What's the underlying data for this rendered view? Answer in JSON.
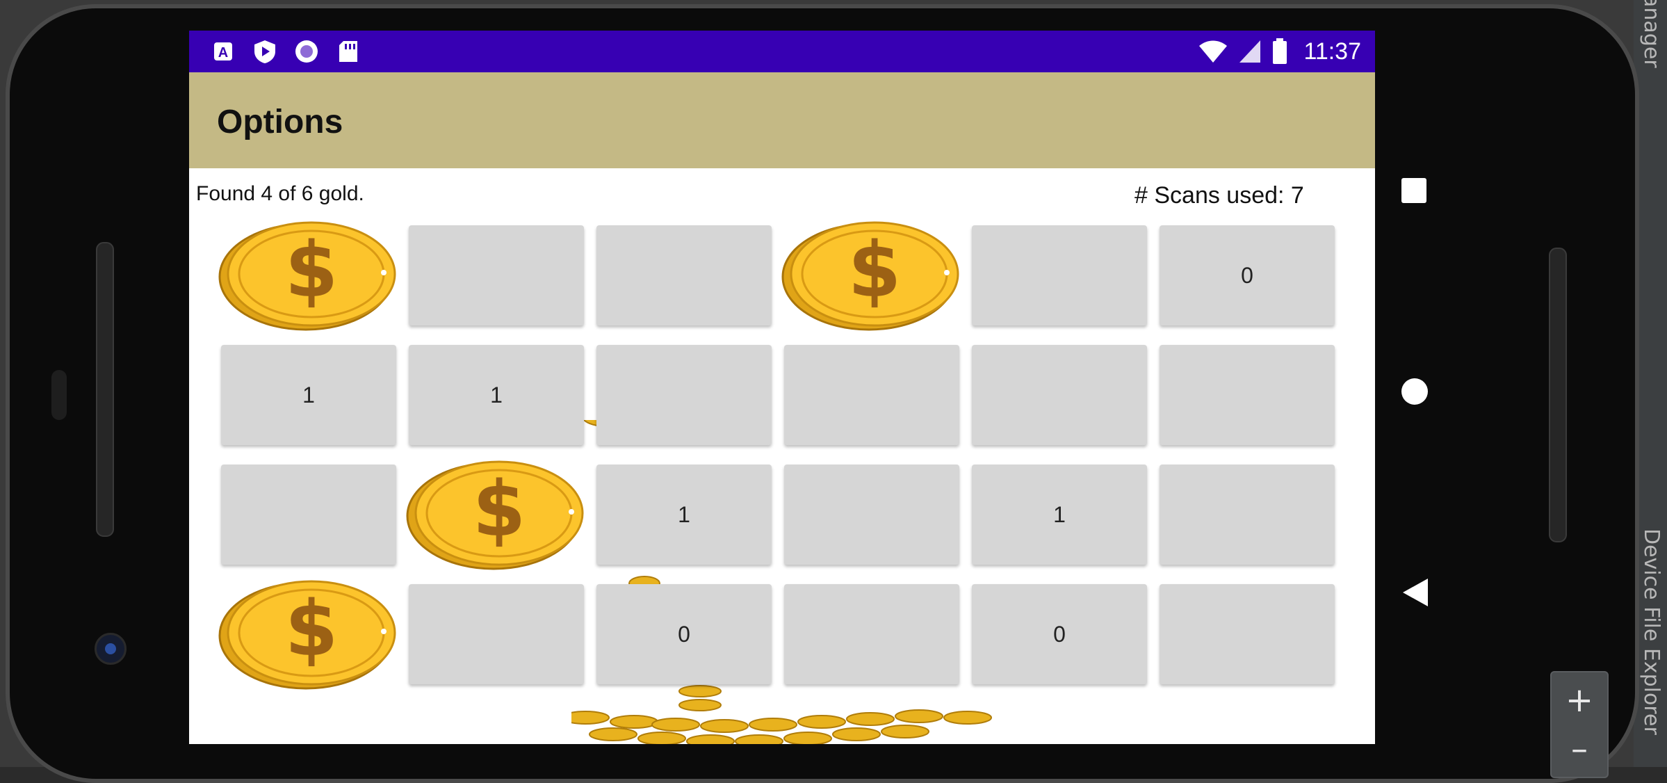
{
  "status_bar": {
    "time": "11:37",
    "left_icons": [
      "a-icon",
      "shield-play-icon",
      "circle-icon",
      "sd-card-icon"
    ],
    "right_icons": [
      "wifi-icon",
      "cell-signal-icon",
      "battery-icon"
    ],
    "color": "#3700b3"
  },
  "app_bar": {
    "title": "Options",
    "color": "#c4b985"
  },
  "game": {
    "found_text": "Found 4 of 6 gold.",
    "scans_text": "# Scans used: 7",
    "rows": 4,
    "cols": 6,
    "cells": [
      [
        "gold",
        "",
        "",
        "gold",
        "",
        "0"
      ],
      [
        "1",
        "1",
        "",
        "",
        "",
        ""
      ],
      [
        "",
        "gold",
        "1",
        "",
        "1",
        ""
      ],
      [
        "gold",
        "",
        "0",
        "",
        "0",
        ""
      ]
    ]
  },
  "nav_bar": {
    "buttons": [
      "recents-button",
      "home-button",
      "back-button"
    ]
  },
  "ide": {
    "side_label_top": "anager",
    "side_label_bottom": "Device File Explorer",
    "zoom_in": "+",
    "zoom_out": "–"
  }
}
